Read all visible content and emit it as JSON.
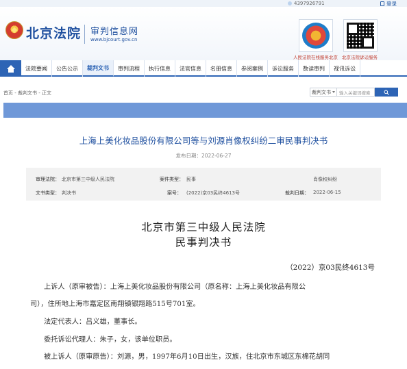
{
  "topbar": {
    "visits": "4397926791",
    "login": "登录"
  },
  "header": {
    "brand": "北京法院",
    "subtitle": "审判信息网",
    "domain": "www.bjcourt.gov.cn",
    "qr_labels": [
      "人民法院在线服务北京",
      "北京法院诉讼服务"
    ]
  },
  "nav": {
    "items": [
      "法院要闻",
      "公告公示",
      "裁判文书",
      "审判流程",
      "执行信息",
      "法官信息",
      "名册信息",
      "参阅案例",
      "诉讼服务",
      "数读审判",
      "视讯诉讼"
    ],
    "active": "裁判文书"
  },
  "breadcrumb": "首页 - 裁判文书 - 正文",
  "search": {
    "select": "裁判文书",
    "placeholder": "输入关键词搜索",
    "button": ""
  },
  "case": {
    "title": "上海上美化妆品股份有限公司等与刘源肖像权纠纷二审民事判决书",
    "published": "发布日期：2022-06-27"
  },
  "info": {
    "court_label": "审理法院：",
    "court_value": "北京市第三中级人民法院",
    "type_label": "案件类型：",
    "type_value": "民事",
    "cause_value": "肖像权纠纷",
    "doctype_label": "文书类型：",
    "doctype_value": "判决书",
    "caseno_label": "案号：",
    "caseno_value": "(2022)京03民终4613号",
    "date_label": "裁判日期：",
    "date_value": "2022-06-15"
  },
  "doc": {
    "court": "北京市第三中级人民法院",
    "doctype": "民事判决书",
    "caseno": "（2022）京03民终4613号",
    "p1_line1": "上诉人（原审被告）：上海上美化妆品股份有限公司（原名称：上海上美化妆品有限公",
    "p1_line2": "司），住所地上海市嘉定区南翔镇银翔路515号701室。",
    "p2": "法定代表人：吕义雄，董事长。",
    "p3": "委托诉讼代理人：朱子，女，该单位职员。",
    "p4": "被上诉人（原审原告）：刘源，男，1997年6月10日出生，汉族，住北京市东城区东棉花胡同"
  }
}
